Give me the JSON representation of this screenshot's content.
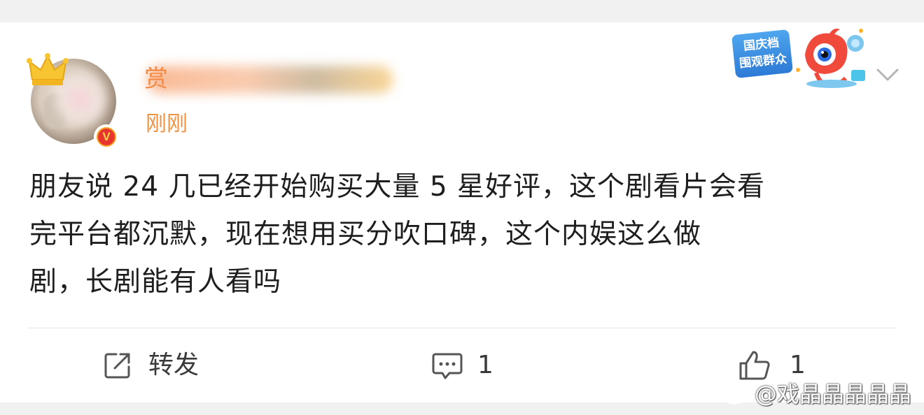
{
  "post": {
    "author": {
      "name": "赏",
      "verified_badge": "V"
    },
    "timestamp": "刚刚",
    "sticker": {
      "line1": "国庆档",
      "line2": "围观群众"
    },
    "text_lines": [
      "朋友说 24 几已经开始购买大量 5 星好评，这个剧看片会看",
      "完平台都沉默，现在想用买分吹口碑，这个内娱这么做",
      "剧，长剧能有人看吗"
    ]
  },
  "actions": {
    "repost_label": "转发",
    "comment_count": "1",
    "like_count": "1"
  },
  "watermark": {
    "text": "@戏晶晶晶晶晶"
  },
  "colors": {
    "accent_orange": "#f09240",
    "text": "#1e1e1e",
    "background": "#f1f1f1"
  },
  "icons": [
    "crown-icon",
    "verified-v-icon",
    "chevron-down-icon",
    "repost-icon",
    "comment-icon",
    "like-icon",
    "weibo-logo-icon"
  ]
}
